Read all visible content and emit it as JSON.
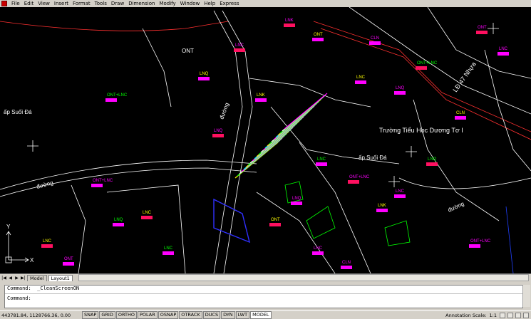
{
  "menu": [
    "File",
    "Edit",
    "View",
    "Insert",
    "Format",
    "Tools",
    "Draw",
    "Dimension",
    "Modify",
    "Window",
    "Help",
    "Express"
  ],
  "drawing": {
    "labels": [
      {
        "text": "ONT"
      },
      {
        "text": "ấp Suối Đá"
      },
      {
        "text": "ấp Suối Đá"
      },
      {
        "text": "đường"
      },
      {
        "text": "đường"
      },
      {
        "text": "đường"
      },
      {
        "text": "Trường Tiểu Học Dương Tơ I"
      },
      {
        "text": "LĐ 47 Nhựa"
      }
    ],
    "parcel_codes": [
      "LNC",
      "LNQ",
      "ONT+LNC",
      "LNK",
      "ONT",
      "CLN",
      "ONT+LNC",
      "LNQ",
      "LNC",
      "ONT",
      "LNC",
      "CLN",
      "LNQ",
      "LNC",
      "LNK",
      "ONT+LNC",
      "LNC",
      "LNQ",
      "ONT",
      "LNC",
      "CLN",
      "LNC",
      "LNQ",
      "ONT+LNC",
      "LNC",
      "ONT",
      "LNC",
      "LNQ",
      "LNK",
      "ONT+LNC"
    ]
  },
  "tabs": {
    "model": "Model",
    "layout1": "Layout1"
  },
  "command": {
    "line1": "Command:  _CleanScreenON",
    "line2": "Command:"
  },
  "status": {
    "coords": "443781.84, 1128766.36, 0.00",
    "toggles": [
      "SNAP",
      "GRID",
      "ORTHO",
      "POLAR",
      "OSNAP",
      "OTRACK",
      "DUCS",
      "DYN",
      "LWT",
      "MODEL"
    ],
    "annotation_label": "Annotation Scale:",
    "annotation_value": "1:1"
  }
}
